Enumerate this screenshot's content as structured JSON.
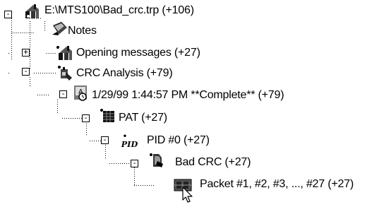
{
  "tree": {
    "nodes": [
      {
        "id": "root",
        "label": "E:\\MTS100\\Bad_crc.trp (+106)",
        "icon": "capture-file-icon",
        "expander": "-",
        "expanded": true
      },
      {
        "id": "notes",
        "label": "Notes",
        "icon": "notes-icon",
        "expander": null
      },
      {
        "id": "opening",
        "label": "Opening messages (+27)",
        "icon": "messages-icon",
        "expander": "+",
        "expanded": false
      },
      {
        "id": "crc",
        "label": "CRC Analysis (+79)",
        "icon": "analysis-icon",
        "expander": "-",
        "expanded": true
      },
      {
        "id": "run",
        "label": "1/29/99 1:44:57 PM **Complete** (+79)",
        "icon": "analysis-run-icon",
        "expander": "-",
        "expanded": true
      },
      {
        "id": "pat",
        "label": "PAT (+27)",
        "icon": "pat-table-icon",
        "expander": "-",
        "expanded": true
      },
      {
        "id": "pid",
        "label": "PID #0 (+27)",
        "icon": "pid-icon",
        "expander": "-",
        "expanded": true
      },
      {
        "id": "badcrc",
        "label": "Bad CRC (+27)",
        "icon": "bad-crc-icon",
        "expander": "-",
        "expanded": true
      },
      {
        "id": "packets",
        "label": "Packet #1, #2, #3, ..., #27 (+27)",
        "icon": "packet-icon",
        "expander": null
      }
    ]
  },
  "cursor": {
    "icon": "mouse-pointer-icon"
  }
}
